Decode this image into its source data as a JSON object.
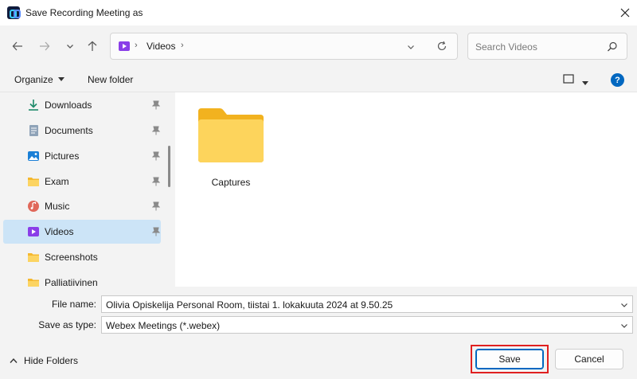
{
  "window": {
    "title": "Save Recording Meeting as"
  },
  "address_bar": {
    "segments": [
      "Videos"
    ]
  },
  "search": {
    "placeholder": "Search Videos"
  },
  "commands": {
    "organize": "Organize",
    "new_folder": "New folder"
  },
  "sidebar": {
    "items": [
      {
        "label": "Downloads",
        "icon": "download-icon",
        "pinned": true
      },
      {
        "label": "Documents",
        "icon": "document-icon",
        "pinned": true
      },
      {
        "label": "Pictures",
        "icon": "pictures-icon",
        "pinned": true
      },
      {
        "label": "Exam",
        "icon": "folder-icon",
        "pinned": true
      },
      {
        "label": "Music",
        "icon": "music-icon",
        "pinned": true
      },
      {
        "label": "Videos",
        "icon": "videos-icon",
        "pinned": true,
        "selected": true
      },
      {
        "label": "Screenshots",
        "icon": "folder-icon",
        "pinned": false
      },
      {
        "label": "Palliatiivinen",
        "icon": "folder-icon",
        "pinned": false
      }
    ]
  },
  "content": {
    "folders": [
      {
        "name": "Captures"
      }
    ]
  },
  "form": {
    "file_name_label": "File name:",
    "file_name_value": "Olivia Opiskelija Personal Room, tiistai 1. lokakuuta 2024 at 9.50.25",
    "save_type_label": "Save as type:",
    "save_type_value": "Webex Meetings (*.webex)"
  },
  "footer": {
    "hide_folders": "Hide Folders",
    "save": "Save",
    "cancel": "Cancel"
  },
  "colors": {
    "accent": "#0067c0",
    "selected_bg": "#cce4f7",
    "highlight": "#e02020",
    "folder": "#f8c94a"
  }
}
